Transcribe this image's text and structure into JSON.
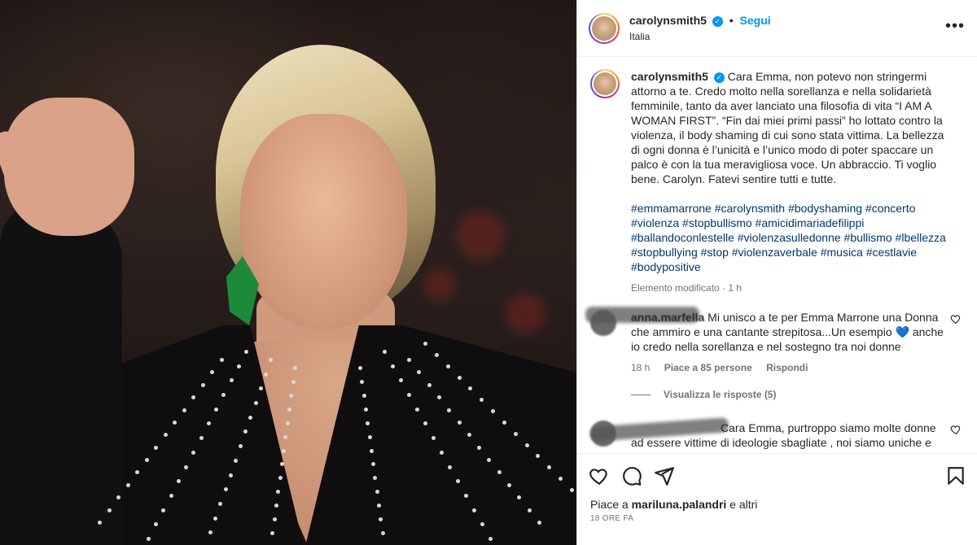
{
  "post": {
    "username": "carolynsmith5",
    "verified_mark": "✓",
    "separator": "•",
    "follow_label": "Segui",
    "location": "Italia",
    "more_label": "•••"
  },
  "caption": {
    "username": "carolynsmith5",
    "text": "Cara Emma, non potevo non stringermi attorno a te. Credo molto nella sorellanza e nella solidarietà femminile, tanto da aver lanciato una filosofia di vita “I AM A WOMAN FIRST”. “Fin dai miei primi passi” ho lottato contro la violenza, il body shaming di cui sono stata vittima. La bellezza di ogni donna è l’unicità e l’unico modo di poter spaccare un palco è con la tua meravigliosa voce. Un abbraccio. Ti voglio bene. Carolyn. Fatevi sentire tutti e tutte.",
    "hashtags": "#emmamarrone #carolynsmith #bodyshaming #concerto #violenza #stopbullismo #amicidimariadefilippi #ballandoconlestelle #violenzasulledonne #bullismo #lbellezza #stopbullying #stop #violenzaverbale #musica #cestlavie #bodypositive",
    "meta": "Elemento modificato · 1 h"
  },
  "comments": [
    {
      "username": "anna.marfella",
      "text": "Mi unisco a te per Emma Marrone una Donna che ammiro e una cantante strepitosa...Un esempio 💙 anche io credo nella sorellanza e nel sostegno tra noi donne",
      "time": "18 h",
      "likes": "Piace a 85 persone",
      "reply": "Rispondi",
      "view_replies": "Visualizza le risposte (5)"
    },
    {
      "username": "",
      "text": "Cara Emma, purtroppo siamo molte donne ad essere vittime di ideologie sbagliate , noi siamo uniche e"
    }
  ],
  "footer": {
    "likes_prefix": "Piace a ",
    "likes_user": "mariluna.palandri",
    "likes_suffix": " e altri",
    "date": "18 ORE FA"
  },
  "colors": {
    "link_blue": "#0095f6",
    "hashtag_blue": "#00376b",
    "muted": "#737373",
    "text": "#262626"
  },
  "icons": [
    "more-icon",
    "verified-icon",
    "heart-icon",
    "comment-icon",
    "share-icon",
    "bookmark-icon"
  ]
}
